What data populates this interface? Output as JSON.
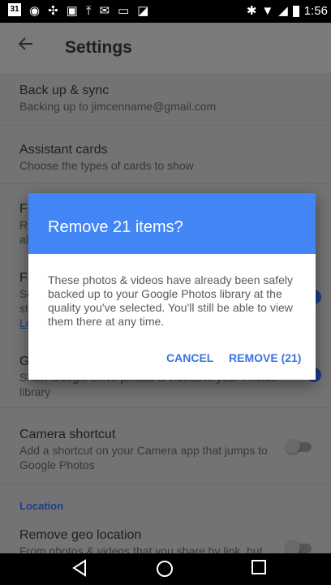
{
  "status_bar": {
    "time": "1:56",
    "left_icons": [
      "calendar-icon",
      "aperture-icon",
      "pinwheel-icon",
      "image-icon",
      "upload-icon",
      "gmail-icon",
      "square-icon",
      "photo-stack-icon"
    ],
    "calendar_day": "31"
  },
  "app_bar": {
    "title": "Settings"
  },
  "settings": [
    {
      "title": "Back up & sync",
      "subtitle": "Backing up to jimcenname@gmail.com"
    },
    {
      "title": "Assistant cards",
      "subtitle": "Choose the types of cards to show"
    },
    {
      "title": "Camera shortcut",
      "subtitle1": "Add a shortcut on your Camera app that jumps to",
      "subtitle2": "Google Photos"
    },
    {
      "title": "Remove geo location",
      "subtitle": "From photos & videos that you share by link, but"
    }
  ],
  "partial": {
    "f_row_title": "F",
    "f_row_sub1": "R",
    "f_row_sub2": "al",
    "fa_row_title": "Fa",
    "fa_row_sub1": "Se",
    "fa_row_sub2": "st",
    "fa_row_link": "Le",
    "g_row_title": "G",
    "g_row_sub1": "Show Google Drive photos & videos in your Photos",
    "g_row_sub2": "library"
  },
  "section_location": "Location",
  "dialog": {
    "title": "Remove 21 items?",
    "body": "These photos & videos have already been safely backed up to your Google Photos library at the quality you've selected. You'll still be able to view them there at any time.",
    "cancel_label": "CANCEL",
    "confirm_label": "REMOVE (21)"
  },
  "nav": {
    "back": "◁",
    "home": "○",
    "recents": "□"
  },
  "colors": {
    "accent": "#4285f4",
    "button_text": "#3b73e0",
    "scrim_bg": "#737373"
  }
}
